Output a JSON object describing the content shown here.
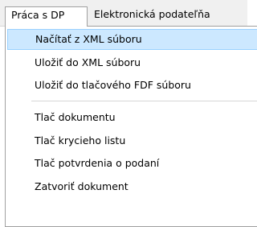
{
  "menubar": {
    "items": [
      {
        "label": "Práca s DP"
      },
      {
        "label": "Elektronická podateľňa"
      }
    ]
  },
  "dropdown": {
    "items": [
      {
        "label": "Načítať z XML súboru",
        "highlighted": true
      },
      {
        "label": "Uložiť do XML súboru"
      },
      {
        "label": "Uložiť do tlačového FDF súboru"
      },
      {
        "label": "Tlač dokumentu"
      },
      {
        "label": "Tlač krycieho listu"
      },
      {
        "label": "Tlač potvrdenia o podaní"
      },
      {
        "label": "Zatvoriť dokument"
      }
    ]
  },
  "colors": {
    "highlight_bg": "#cce8ff",
    "highlight_border": "#99d1ff",
    "menubar_bg": "#f0f0f0"
  }
}
